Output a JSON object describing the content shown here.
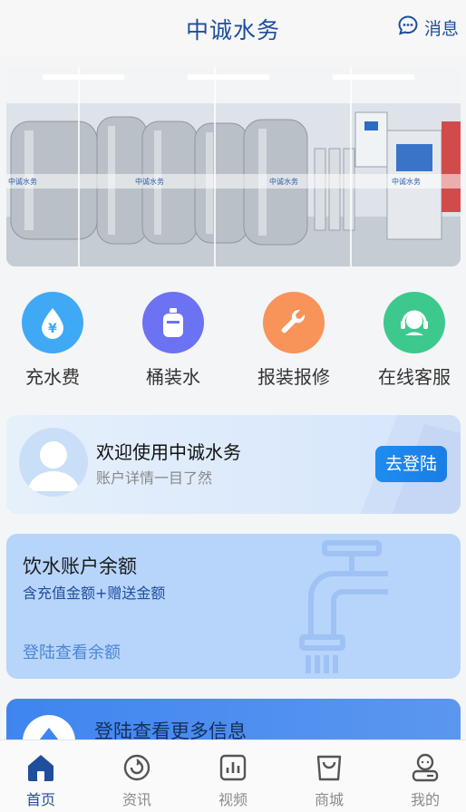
{
  "header": {
    "title": "中诚水务",
    "message_label": "消息",
    "message_icon": "chat-bubble-icon"
  },
  "banner": {
    "alt_brand_text": "中诚水务"
  },
  "actions": [
    {
      "label": "充水费",
      "icon": "water-drop-yen-icon",
      "color": "#3fa9f5"
    },
    {
      "label": "桶装水",
      "icon": "water-bottle-icon",
      "color": "#6b73f2"
    },
    {
      "label": "报装报修",
      "icon": "wrench-icon",
      "color": "#f8935a"
    },
    {
      "label": "在线客服",
      "icon": "headset-agent-icon",
      "color": "#3dc98e"
    }
  ],
  "login_card": {
    "welcome": "欢迎使用中诚水务",
    "subtitle": "账户详情一目了然",
    "button": "去登陆"
  },
  "balance_card": {
    "title": "饮水账户余额",
    "subtitle": "含充值金额+赠送金额",
    "action": "登陆查看余额"
  },
  "more_card": {
    "text": "登陆查看更多信息"
  },
  "tabbar": [
    {
      "label": "首页",
      "icon": "home-icon",
      "active": true
    },
    {
      "label": "资讯",
      "icon": "news-icon",
      "active": false
    },
    {
      "label": "视频",
      "icon": "video-chart-icon",
      "active": false
    },
    {
      "label": "商城",
      "icon": "shopping-bag-icon",
      "active": false
    },
    {
      "label": "我的",
      "icon": "user-icon",
      "active": false
    }
  ],
  "colors": {
    "brand": "#1f4e9c",
    "login_button": "#1e8cf0",
    "balance_bg": "#b7d4fb"
  }
}
